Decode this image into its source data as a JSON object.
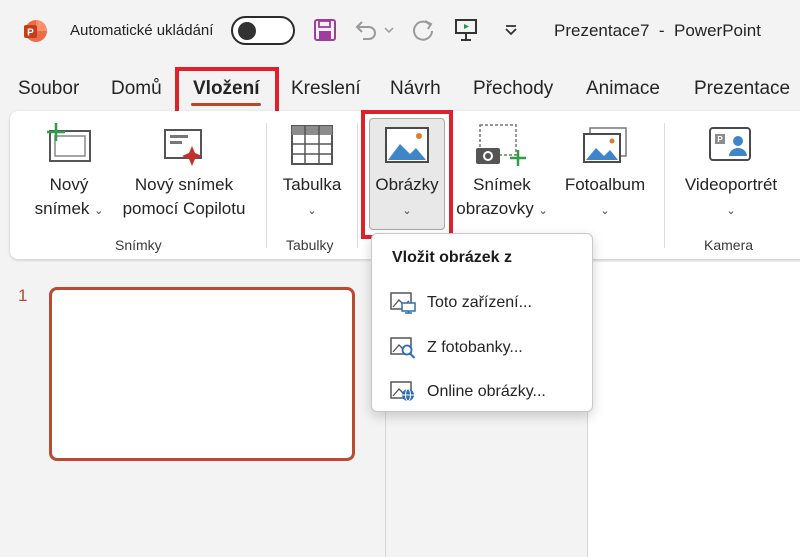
{
  "titlebar": {
    "autosave_label": "Automatické ukládání",
    "autosave_state": "off",
    "document_title": "Prezentace7  -  PowerPoint",
    "quick_access_icons": [
      "save-icon",
      "undo-icon",
      "undo-dropdown-icon",
      "redo-icon",
      "present-from-start-icon",
      "customize-qat-icon"
    ]
  },
  "tabs": [
    {
      "label": "Soubor"
    },
    {
      "label": "Domů"
    },
    {
      "label": "Vložení",
      "active": true
    },
    {
      "label": "Kreslení"
    },
    {
      "label": "Návrh"
    },
    {
      "label": "Přechody"
    },
    {
      "label": "Animace"
    },
    {
      "label": "Prezentace"
    }
  ],
  "ribbon": {
    "slides_group": {
      "label": "Snímky",
      "new_slide": {
        "line1": "Nový",
        "line2": "snímek"
      },
      "copilot_slide": {
        "line1": "Nový snímek",
        "line2": "pomocí Copilotu"
      }
    },
    "tables_group": {
      "label": "Tabulky",
      "table": {
        "line1": "Tabulka"
      }
    },
    "images_group": {
      "pictures": {
        "line1": "Obrázky"
      },
      "screenshot": {
        "line1": "Snímek",
        "line2": "obrazovky"
      },
      "photo_album": {
        "line1": "Fotoalbum"
      }
    },
    "camera_group": {
      "label": "Kamera",
      "cameo": {
        "line1": "Videoportrét"
      }
    }
  },
  "insert_picture_menu": {
    "title": "Vložit obrázek z",
    "items": [
      {
        "label": "Toto zařízení...",
        "icon": "device-picture-icon"
      },
      {
        "label": "Z fotobanky...",
        "icon": "stock-images-icon"
      },
      {
        "label": "Online obrázky...",
        "icon": "online-pictures-icon"
      }
    ]
  },
  "slides_pane": {
    "slide_number": "1"
  },
  "colors": {
    "accent": "#b7472a",
    "highlight_box": "#e0202a",
    "thumb_border": "#b94a33"
  }
}
